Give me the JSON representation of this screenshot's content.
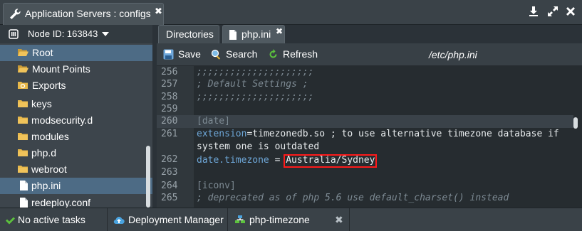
{
  "window": {
    "title": "Application Servers : configs",
    "close_glyph": "✖",
    "controls": [
      "download-icon",
      "maximize-icon",
      "close-icon"
    ]
  },
  "sidebar": {
    "node_label": "Node ID: 163843",
    "items": [
      {
        "label": "Root",
        "selected": true
      },
      {
        "label": "Mount Points"
      },
      {
        "label": "Exports"
      },
      {
        "label": "keys"
      },
      {
        "label": "modsecurity.d"
      },
      {
        "label": "modules"
      },
      {
        "label": "php.d"
      },
      {
        "label": "webroot"
      },
      {
        "label": "php.ini",
        "selected": true
      },
      {
        "label": "redeploy.conf"
      }
    ]
  },
  "tabs": [
    {
      "label": "Directories"
    },
    {
      "label": "php.ini",
      "active": true,
      "close_glyph": "✖"
    }
  ],
  "toolbar": {
    "save_label": "Save",
    "search_label": "Search",
    "refresh_label": "Refresh",
    "file_path": "/etc/php.ini"
  },
  "editor": {
    "lines": [
      {
        "num": "256",
        "text": ";;;;;;;;;;;;;;;;;;;;;",
        "kind": "comment"
      },
      {
        "num": "257",
        "text": "; Default Settings ;",
        "kind": "comment"
      },
      {
        "num": "258",
        "text": ";;;;;;;;;;;;;;;;;;;;;",
        "kind": "comment"
      },
      {
        "num": "259",
        "text": "",
        "kind": "plain"
      },
      {
        "num": "260",
        "text": "[date]",
        "kind": "section",
        "active": true
      },
      {
        "num": "261",
        "text_key": "extension",
        "text_rest": "=timezonedb.so ; to use alternative timezone database if",
        "kind": "kv"
      },
      {
        "num": "",
        "text": "system one is outdated",
        "kind": "plain"
      },
      {
        "num": "262",
        "text_key": "date.timezone",
        "text_rest": " = ",
        "highlight": "Australia/Sydney",
        "kind": "kvhl"
      },
      {
        "num": "263",
        "text": "",
        "kind": "plain"
      },
      {
        "num": "264",
        "text": "[iconv]",
        "kind": "section"
      },
      {
        "num": "265",
        "text": "; deprecated as of php 5.6 use default_charset() instead",
        "kind": "comment"
      }
    ]
  },
  "statusbar": {
    "tasks_label": "No active tasks",
    "deploy_label": "Deployment Manager",
    "env_label": "php-timezone",
    "close_glyph": "✖"
  },
  "colors": {
    "accent_blue": "#4d6b85",
    "highlight_red": "#ff1a1a",
    "check_green": "#5cc23d",
    "folder_yellow": "#e8b84a"
  }
}
